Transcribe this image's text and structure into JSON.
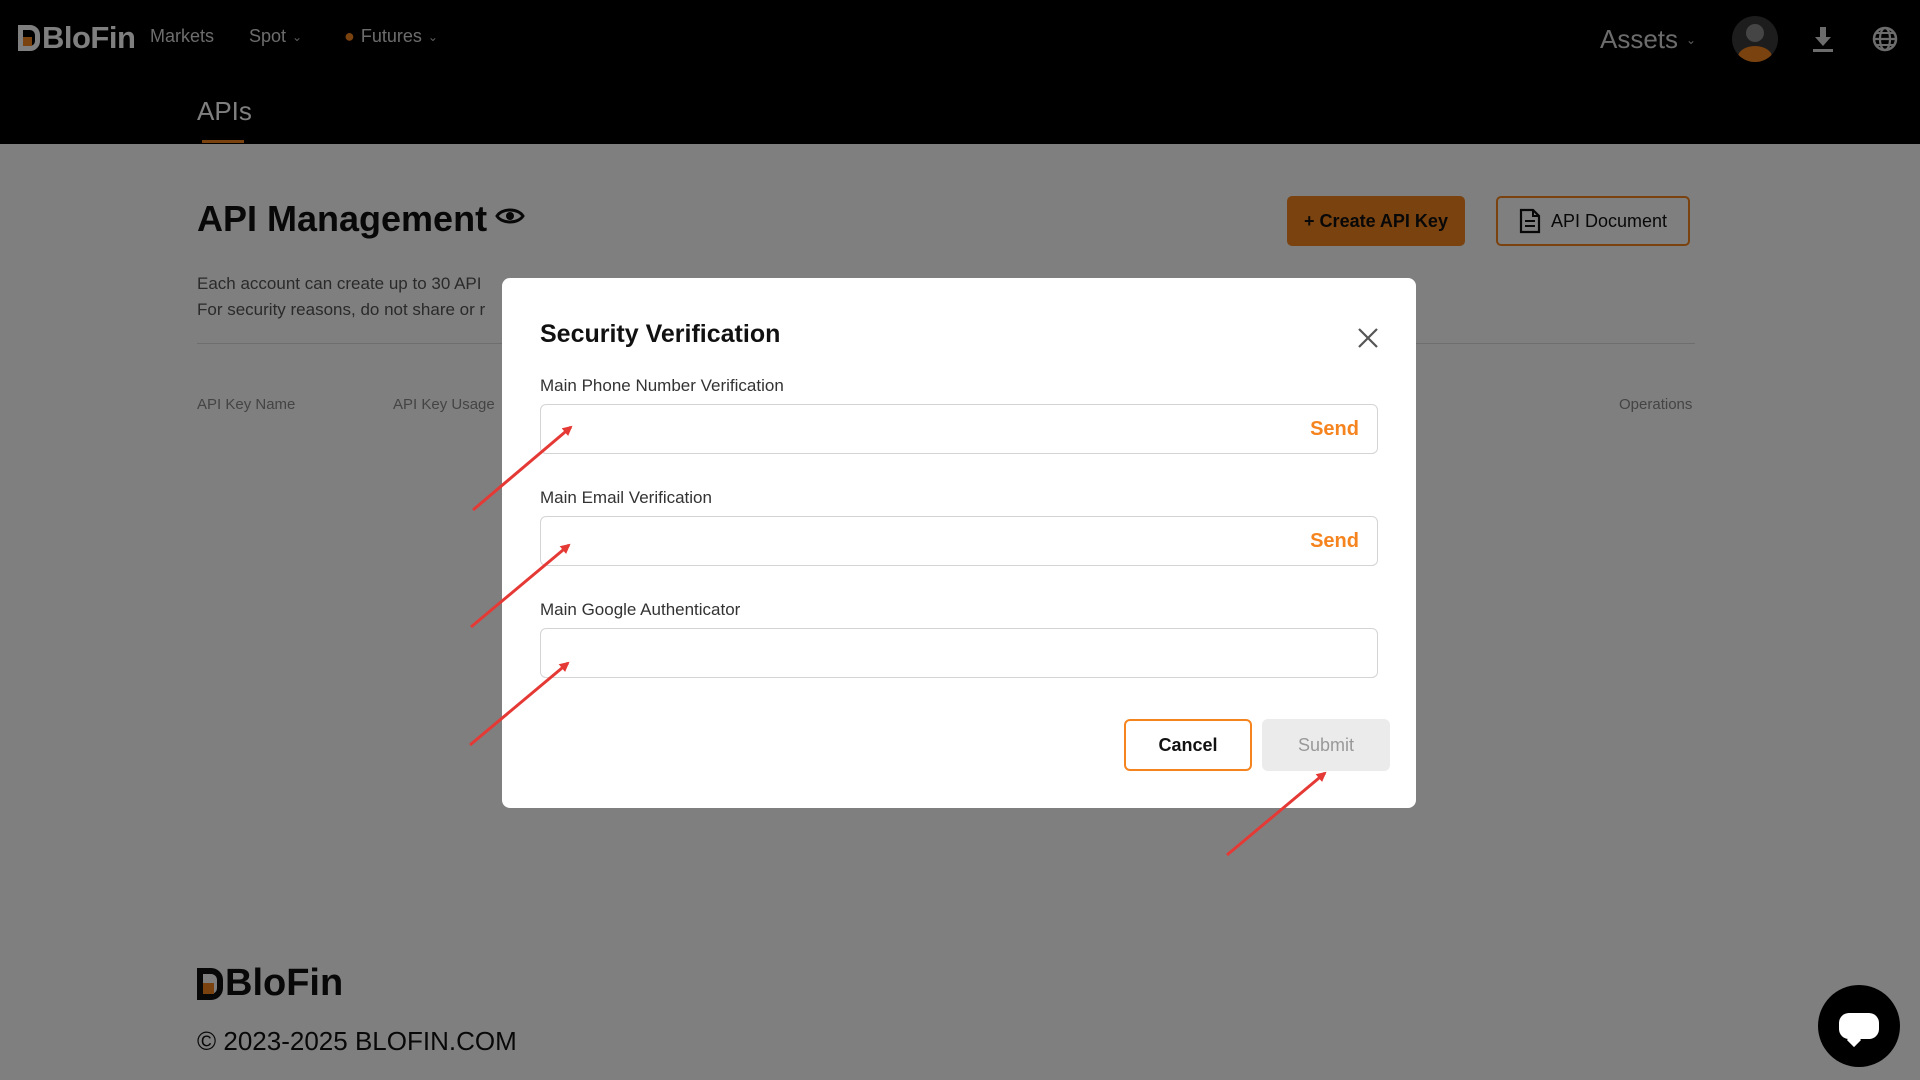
{
  "header": {
    "logo_text": "BloFin",
    "nav": {
      "markets": "Markets",
      "spot": "Spot",
      "futures": "Futures"
    },
    "assets": "Assets",
    "icons": [
      "avatar",
      "download-icon",
      "globe-icon"
    ]
  },
  "subnav": {
    "tab": "APIs"
  },
  "page": {
    "title": "API Management",
    "create_button": "+ Create API Key",
    "doc_button": "API Document",
    "desc_line1": "Each account can create up to 30 API",
    "desc_line2": "For security reasons, do not share or r",
    "columns": {
      "name": "API Key Name",
      "usage": "API Key Usage",
      "operations": "Operations"
    }
  },
  "modal": {
    "title": "Security Verification",
    "fields": [
      {
        "label": "Main Phone Number Verification",
        "value": "",
        "action": "Send"
      },
      {
        "label": "Main Email Verification",
        "value": "",
        "action": "Send"
      },
      {
        "label": "Main Google Authenticator",
        "value": ""
      }
    ],
    "cancel": "Cancel",
    "submit": "Submit"
  },
  "footer": {
    "logo_text": "BloFin",
    "copyright": "© 2023-2025 BLOFIN.COM"
  },
  "colors": {
    "accent": "#f5841f",
    "annotation_arrow": "#e53935",
    "navbar": "#000000"
  }
}
